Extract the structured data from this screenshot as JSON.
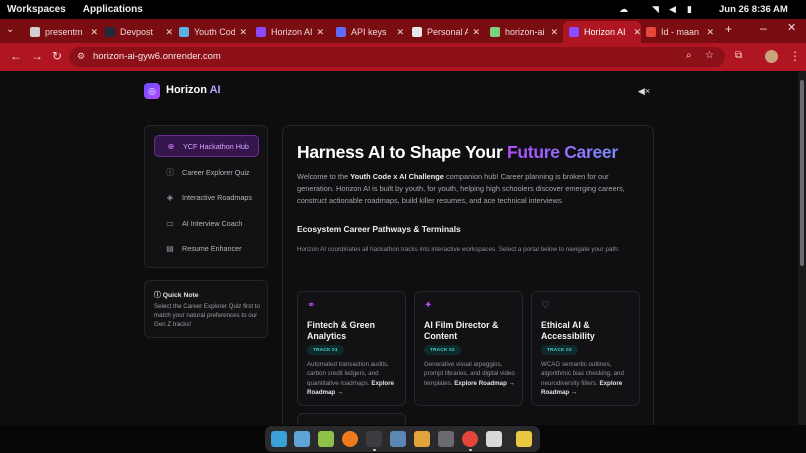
{
  "topbar": {
    "workspaces": "Workspaces",
    "applications": "Applications",
    "clock": "Jun 26  8:36 AM"
  },
  "tabs": [
    {
      "title": "presentm",
      "color": "#cfcfcf"
    },
    {
      "title": "Devpost",
      "color": "#1c2a3a"
    },
    {
      "title": "Youth Code",
      "color": "#5fb0e6"
    },
    {
      "title": "Horizon AI",
      "color": "#8a4bff"
    },
    {
      "title": "API keys",
      "color": "#5f6cff"
    },
    {
      "title": "Personal A",
      "color": "#e6e6e6"
    },
    {
      "title": "horizon-ai",
      "color": "#7bd07b"
    },
    {
      "title": "Horizon AI",
      "color": "#8a4bff",
      "active": true
    },
    {
      "title": "Id - maan",
      "color": "#e8453c"
    }
  ],
  "address": {
    "url": "horizon-ai-gyw6.onrender.com"
  },
  "app": {
    "brand_name": "Horizon",
    "brand_ai": "AI"
  },
  "sidebar": {
    "items": [
      {
        "label": "YCF Hackathon Hub",
        "icon": "globe-icon",
        "active": true
      },
      {
        "label": "Career Explorer Quiz",
        "icon": "help-circle-icon"
      },
      {
        "label": "Interactive Roadmaps",
        "icon": "layers-icon"
      },
      {
        "label": "AI Interview Coach",
        "icon": "chat-icon"
      },
      {
        "label": "Resume Enhancer",
        "icon": "document-icon"
      }
    ]
  },
  "note": {
    "title": "Quick Note",
    "body": "Select the Career Explorer Quiz first to match your natural preferences to our Gen Z tracks!"
  },
  "main": {
    "headline_a": "Harness AI to Shape Your ",
    "headline_b": "Future Career",
    "intro_a": "Welcome to the ",
    "intro_bold": "Youth Code x AI Challenge",
    "intro_b": " companion hub! Career planning is broken for our generation. Horizon AI is built by youth, for youth, helping high schoolers discover emerging careers, construct actionable roadmaps, build killer resumes, and ace technical interviews.",
    "eco_title": "Ecosystem Career Pathways & Terminals",
    "eco_desc": "Horizon AI coordinates all hackathon tracks into interactive workspaces. Select a portal below to navigate your path:",
    "cards": [
      {
        "title": "Fintech & Green Analytics",
        "badge": "TRACK 01",
        "desc": "Automated transaction audits, carbon credit ledgers, and quantitative roadmaps.",
        "cta": "Explore Roadmap →",
        "icon": "link-icon",
        "icon_color": "#b44bff"
      },
      {
        "title": "AI Film Director & Content",
        "badge": "TRACK 02",
        "desc": "Generative visual arpeggios, prompt libraries, and digital video templates.",
        "cta": "Explore Roadmap →",
        "icon": "sparkle-icon",
        "icon_color": "#b44bff"
      },
      {
        "title": "Ethical AI & Accessibility",
        "badge": "TRACK 03",
        "desc": "WCAG semantic outlines, algorithmic bias checking, and neurodiversity filters.",
        "cta": "Explore Roadmap →",
        "icon": "heart-icon",
        "icon_color": "#d05bff"
      }
    ]
  },
  "colors": {
    "tab_bar": "#7a0d12",
    "address_bar": "#b01622",
    "accent_purple": "#b44bff",
    "badge_teal": "#4fd4d4"
  }
}
